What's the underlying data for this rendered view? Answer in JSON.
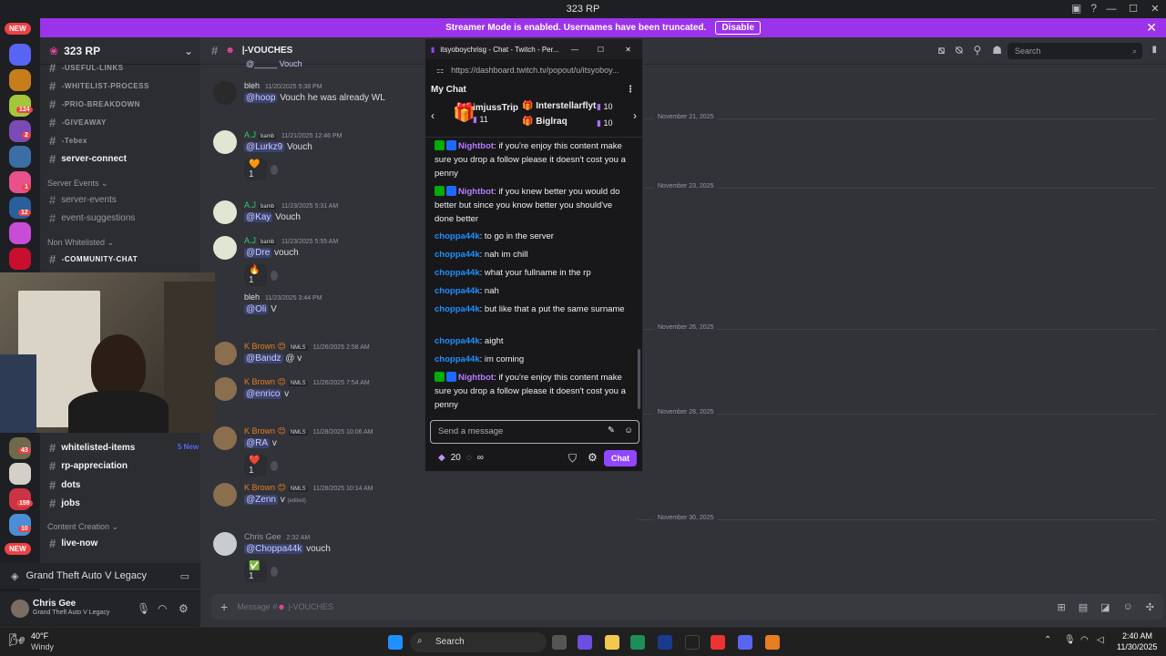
{
  "window": {
    "title": "323 RP"
  },
  "banner": {
    "text": "Streamer Mode is enabled. Usernames have been truncated.",
    "button": "Disable"
  },
  "rail": {
    "new_top": "NEW",
    "new_bottom": "NEW",
    "badges": [
      "124",
      "2",
      "1",
      "12",
      "43",
      "159",
      "10"
    ]
  },
  "server": {
    "name": "323 RP",
    "channels": [
      {
        "name": "-USEFUL-LINKS",
        "style": "caps"
      },
      {
        "name": "-WHITELIST-PROCESS",
        "style": "caps"
      },
      {
        "name": "-PRIO-BREAKDOWN",
        "style": "caps"
      },
      {
        "name": "-GIVEAWAY",
        "style": "caps"
      },
      {
        "name": "-Tebex",
        "style": "caps"
      },
      {
        "name": "server-connect",
        "style": "bold"
      },
      {
        "name": "server-events",
        "style": ""
      },
      {
        "name": "event-suggestions",
        "style": ""
      },
      {
        "name": "-COMMUNITY-CHAT",
        "style": "caps"
      },
      {
        "name": "whitelisted-items",
        "style": "bold"
      },
      {
        "name": "rp-appreciation",
        "style": "bold"
      },
      {
        "name": "dots",
        "style": "bold"
      },
      {
        "name": "jobs",
        "style": "bold"
      },
      {
        "name": "live-now",
        "style": "bold"
      }
    ],
    "categories": [
      "Server Events",
      "Non Whitelisted",
      "Content Creation"
    ],
    "new_label": "5 New"
  },
  "game_activity": "Grand Theft Auto V Legacy",
  "user": {
    "name": "Chris Gee",
    "status": "Grand Theft Auto V Legacy"
  },
  "channel": {
    "name": "|-VOUCHES",
    "search_placeholder": "Search",
    "input_placeholder": "Message #",
    "input_channel": "|-VOUCHES"
  },
  "messages": [
    {
      "author": "bleh",
      "time": "11/20/2025 5:38 PM",
      "mention": "@hoop",
      "text": "Vouch he was already WL"
    },
    {
      "author": "A.J",
      "tag": "bamb",
      "time": "11/21/2025 12:46 PM",
      "mention": "@Lurkz9",
      "text": "Vouch",
      "reaction": "1"
    },
    {
      "author": "A.J",
      "tag": "bamb",
      "time": "11/23/2025 5:31 AM",
      "mention": "@Kay",
      "text": "Vouch"
    },
    {
      "author": "A.J",
      "tag": "bamb",
      "time": "11/23/2025 5:55 AM",
      "mention": "@Dre",
      "text": "vouch",
      "reaction": "1"
    },
    {
      "author": "bleh",
      "time": "11/23/2025 3:44 PM",
      "mention": "@Oli",
      "text": "V"
    },
    {
      "author": "K Brown",
      "tag": "NMLS",
      "time": "11/26/2025 2:58 AM",
      "mention": "@Bandz",
      "text": "@  v"
    },
    {
      "author": "K Brown",
      "tag": "NMLS",
      "time": "11/26/2025 7:54 AM",
      "mention": "@enrico",
      "text": "v"
    },
    {
      "author": "K Brown",
      "tag": "NMLS",
      "time": "11/28/2025 10:06 AM",
      "mention": "@RA",
      "text": "v",
      "reaction": "1"
    },
    {
      "author": "K Brown",
      "tag": "NMLS",
      "time": "11/28/2025 10:14 AM",
      "mention": "@Zenn",
      "text": "v",
      "edited": "(edited)"
    },
    {
      "author": "Chris Gee",
      "time": "2:32 AM",
      "mention": "@Choppa44k",
      "text": "vouch",
      "reaction": "1"
    }
  ],
  "dividers": [
    "November 21, 2025",
    "November 23, 2025",
    "November 26, 2025",
    "November 28, 2025",
    "November 30, 2025"
  ],
  "twitch": {
    "title": "itsyoboychrisg - Chat - Twitch - Per...",
    "url": "https://dashboard.twitch.tv/popout/u/itsyoboy...",
    "header": "My Chat",
    "gifters": [
      {
        "name": "imjussTrip",
        "count": "11"
      },
      {
        "name": "Interstellarflyt",
        "count": "10"
      },
      {
        "name": "Biglraq",
        "count": "10"
      }
    ],
    "chat": [
      {
        "user": "Nightbot",
        "bot": true,
        "text": ": if you're enjoy this content make sure you drop a follow please it doesn't cost you a penny"
      },
      {
        "user": "Nightbot",
        "bot": true,
        "text": ": if you knew better you would do better but since you know better you should've done better"
      },
      {
        "user": "choppa44k",
        "text": ": to go in the server"
      },
      {
        "user": "choppa44k",
        "text": ": nah im chill"
      },
      {
        "user": "choppa44k",
        "text": ": what your fullname in the rp"
      },
      {
        "user": "choppa44k",
        "text": ": nah"
      },
      {
        "user": "choppa44k",
        "text": ": but like that a put the same surname"
      },
      {
        "user": "choppa44k",
        "text": ": aight"
      },
      {
        "user": "choppa44k",
        "text": ": im coming"
      },
      {
        "user": "Nightbot",
        "bot": true,
        "text": ": if you're enjoy this content make sure you drop a follow please it doesn't cost you a penny"
      }
    ],
    "input_placeholder": "Send a message",
    "points": "20",
    "infinity": "∞",
    "chat_button": "Chat"
  },
  "taskbar": {
    "weather_temp": "40°F",
    "weather_desc": "Windy",
    "search": "Search",
    "time": "2:40 AM",
    "date": "11/30/2025"
  }
}
